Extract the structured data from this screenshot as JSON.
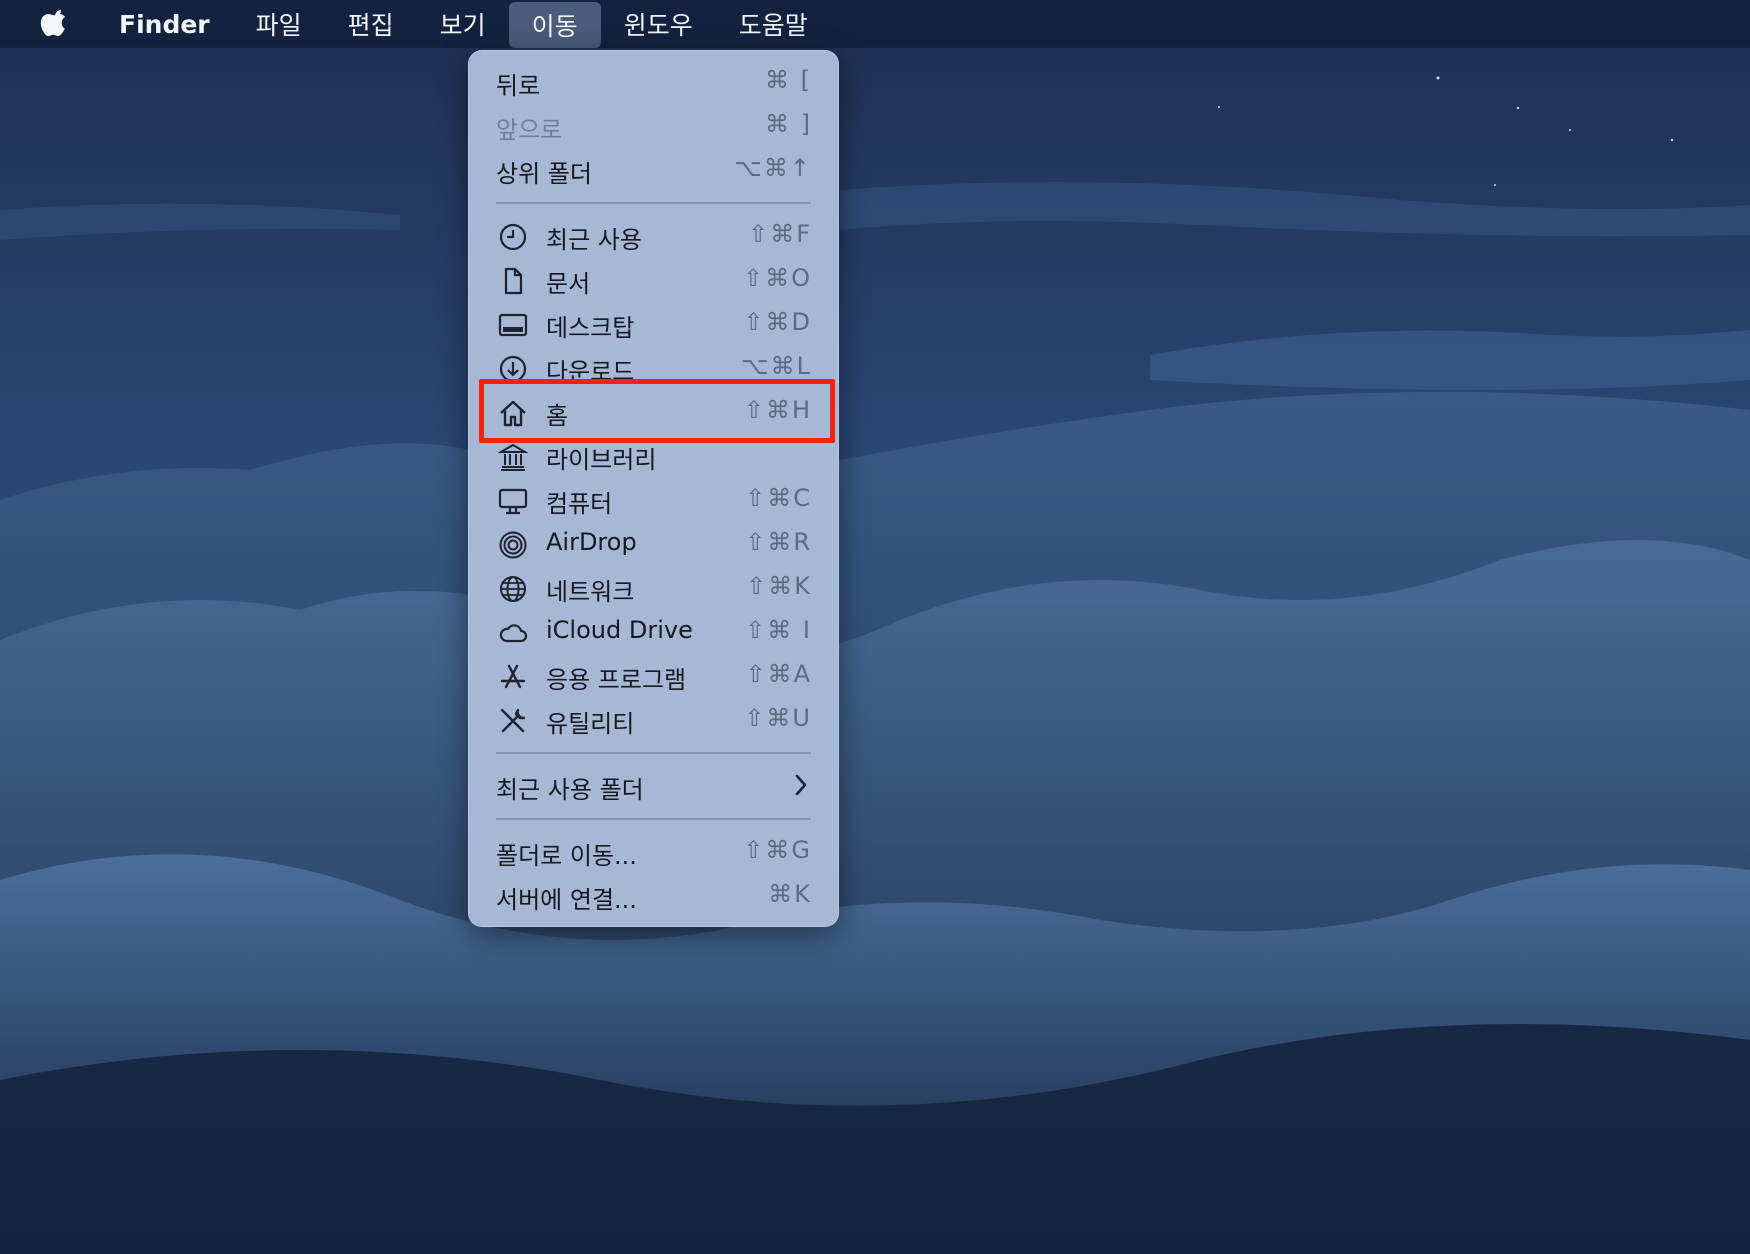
{
  "colors": {
    "menubar_bg": "#12223e",
    "menu_bg": "#a6b8d4",
    "highlight_border": "#f0230d",
    "shortcut_text": "#5d6b80",
    "disabled_text": "#6f7f99"
  },
  "menubar": {
    "apple_icon": "apple-logo-icon",
    "items": [
      {
        "label": "Finder"
      },
      {
        "label": "파일"
      },
      {
        "label": "편집"
      },
      {
        "label": "보기"
      },
      {
        "label": "이동",
        "active": true
      },
      {
        "label": "윈도우"
      },
      {
        "label": "도움말"
      }
    ]
  },
  "go_menu": {
    "items": [
      {
        "label": "뒤로",
        "shortcut": "⌘ [",
        "enabled": true
      },
      {
        "label": "앞으로",
        "shortcut": "⌘ ]",
        "enabled": false
      },
      {
        "label": "상위 폴더",
        "shortcut": "⌥⌘↑",
        "enabled": true
      },
      {
        "label": "최근 사용",
        "shortcut": "⇧⌘F",
        "icon": "clock-icon"
      },
      {
        "label": "문서",
        "shortcut": "⇧⌘O",
        "icon": "document-icon"
      },
      {
        "label": "데스크탑",
        "shortcut": "⇧⌘D",
        "icon": "desktop-icon"
      },
      {
        "label": "다운로드",
        "shortcut": "⌥⌘L",
        "icon": "download-icon"
      },
      {
        "label": "홈",
        "shortcut": "⇧⌘H",
        "icon": "home-icon",
        "highlighted": true
      },
      {
        "label": "라이브러리",
        "shortcut": "",
        "icon": "library-icon"
      },
      {
        "label": "컴퓨터",
        "shortcut": "⇧⌘C",
        "icon": "computer-icon"
      },
      {
        "label": "AirDrop",
        "shortcut": "⇧⌘R",
        "icon": "airdrop-icon"
      },
      {
        "label": "네트워크",
        "shortcut": "⇧⌘K",
        "icon": "network-globe-icon"
      },
      {
        "label": "iCloud Drive",
        "shortcut": "⇧⌘ I",
        "icon": "cloud-icon"
      },
      {
        "label": "응용 프로그램",
        "shortcut": "⇧⌘A",
        "icon": "applications-icon"
      },
      {
        "label": "유틸리티",
        "shortcut": "⇧⌘U",
        "icon": "utilities-tools-icon"
      },
      {
        "label": "최근 사용 폴더",
        "submenu": true,
        "icon": "chevron-right-icon"
      },
      {
        "label": "폴더로 이동...",
        "shortcut": "⇧⌘G"
      },
      {
        "label": "서버에 연결...",
        "shortcut": "⌘K"
      }
    ]
  }
}
